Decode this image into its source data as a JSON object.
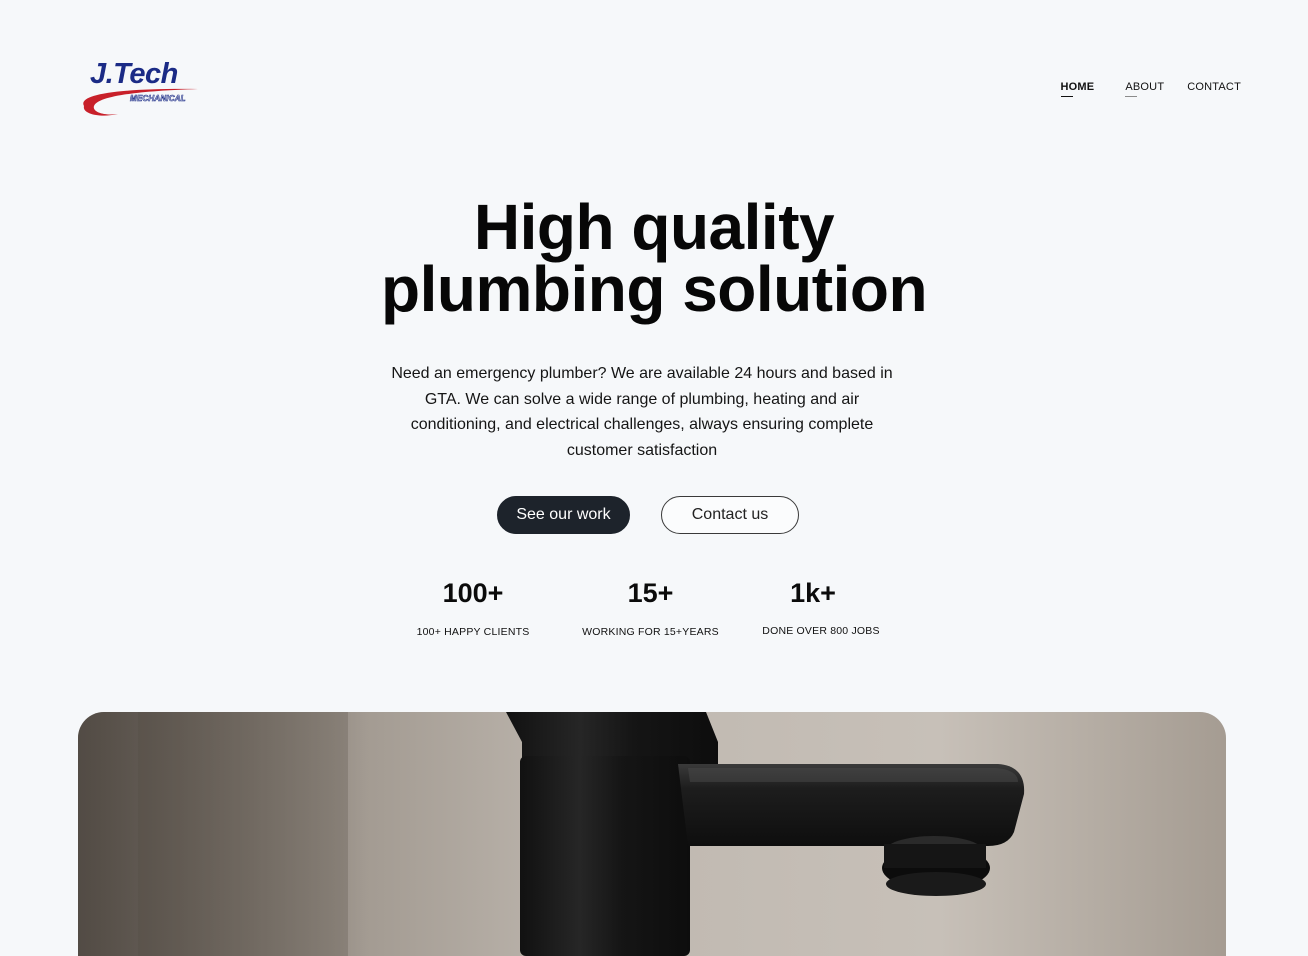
{
  "header": {
    "logo": {
      "text": "J.Tech",
      "subtext": "MECHANICAL",
      "brand_color": "#1b2b86",
      "accent_color": "#c8202a"
    },
    "nav": [
      {
        "label": "HOME",
        "active": true
      },
      {
        "label": "ABOUT",
        "active": false
      },
      {
        "label": "CONTACT",
        "active": false
      }
    ]
  },
  "hero": {
    "title_line1": "High quality",
    "title_line2": "plumbing solution",
    "description": "Need an emergency plumber? We are available 24 hours and based in GTA. We can solve a wide range of plumbing, heating and air conditioning, and electrical challenges, always ensuring complete customer satisfaction",
    "primary_button": "See our work",
    "secondary_button": "Contact us"
  },
  "stats": [
    {
      "value": "100+",
      "label": "100+ HAPPY CLIENTS"
    },
    {
      "value": "15+",
      "label": "WORKING FOR 15+YEARS"
    },
    {
      "value": "1k+",
      "label": "DONE OVER 800 JOBS"
    }
  ],
  "image": {
    "icon": "faucet-photo"
  },
  "colors": {
    "background": "#f6f8fa",
    "primary_button": "#1d232b",
    "text": "#0b0b0b"
  }
}
